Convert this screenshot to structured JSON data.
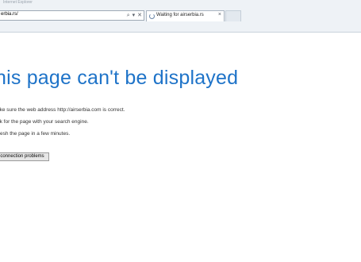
{
  "browser": {
    "title_hint": "Internet Explorer",
    "address": "erbia.rs/",
    "address_icons": {
      "search": "⌕",
      "dropdown": "▾",
      "stop": "✕"
    },
    "active_tab": {
      "label": "Waiting for airserbia.rs",
      "close": "×"
    }
  },
  "error_page": {
    "title": "his page can't be displayed",
    "suggestions": [
      "ake sure the web address http://airserbia.com is correct.",
      "ok for the page with your search engine.",
      "fresh the page in a few minutes."
    ],
    "fix_button_label": "connection problems"
  }
}
